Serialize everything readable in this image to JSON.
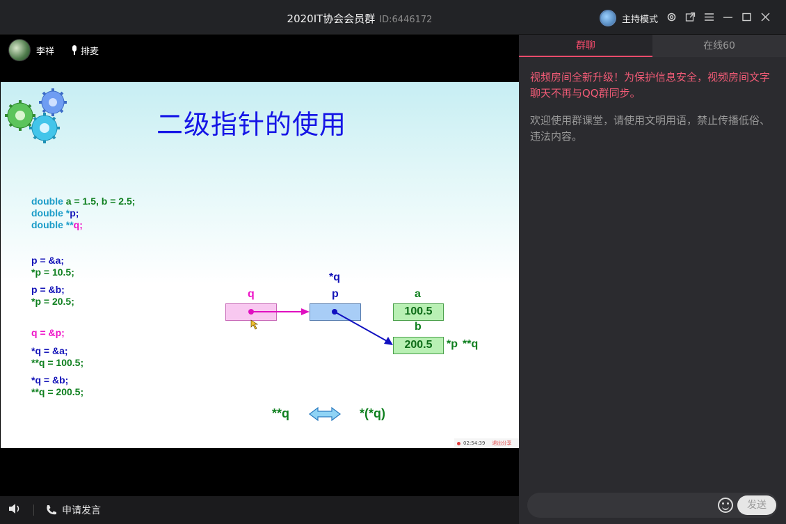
{
  "window": {
    "title": "2020IT协会会员群",
    "room_id": "ID:6446172",
    "host_mode_label": "主持模式"
  },
  "speaker": {
    "name": "李祥",
    "queue_label": "排麦"
  },
  "slide": {
    "title": "二级指针的使用",
    "code": {
      "decl1": [
        "double",
        "a = 1.5, b = 2.5;"
      ],
      "decl2": [
        "double *",
        "p;"
      ],
      "decl3": [
        "double **",
        "q;"
      ],
      "s1": [
        "p = &a;",
        "*p = 10.5;"
      ],
      "s2": [
        "p = &b;",
        "*p = 20.5;"
      ],
      "s3": [
        "q = &p;"
      ],
      "s4": [
        "*q = &a;",
        "**q = 100.5;"
      ],
      "s5": [
        "*q = &b;",
        "**q = 200.5;"
      ]
    },
    "labels": {
      "q": "q",
      "p": "p",
      "star_q": "*q",
      "a": "a",
      "b": "b",
      "star_p": "*p",
      "dstar_q": "**q",
      "equiv_left": "**q",
      "equiv_right": "*(*q)"
    },
    "values": {
      "a": "100.5",
      "b": "200.5"
    },
    "recording": {
      "time": "02:54:39",
      "exit_share": "退出分享"
    }
  },
  "bottom": {
    "request_speak": "申请发言"
  },
  "chat": {
    "tabs": [
      {
        "label": "群聊"
      },
      {
        "label": "在线60"
      }
    ],
    "notice": "视频房间全新升级！为保护信息安全，视频房间文字聊天不再与QQ群同步。",
    "welcome": "欢迎使用群课堂，请使用文明用语，禁止传播低俗、违法内容。",
    "send_label": "发送"
  },
  "colors": {
    "accent": "#f24b6b",
    "slide_title": "#1515e6"
  }
}
